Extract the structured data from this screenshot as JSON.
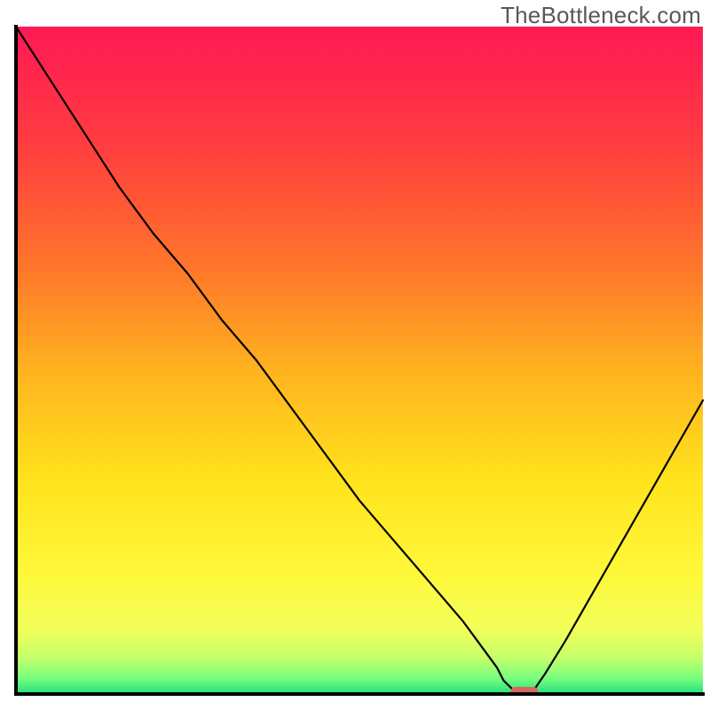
{
  "watermark": "TheBottleneck.com",
  "chart_data": {
    "type": "line",
    "title": "",
    "xlabel": "",
    "ylabel": "",
    "xlim": [
      0,
      100
    ],
    "ylim": [
      0,
      100
    ],
    "x": [
      0,
      5,
      10,
      15,
      20,
      25,
      30,
      35,
      40,
      45,
      50,
      55,
      60,
      65,
      70,
      71,
      72,
      73,
      74,
      75,
      77,
      80,
      85,
      90,
      95,
      100
    ],
    "values": [
      100,
      92,
      84,
      76,
      69,
      63,
      56,
      50,
      43,
      36,
      29,
      23,
      17,
      11,
      4,
      2,
      1,
      0,
      0,
      0,
      3,
      8,
      17,
      26,
      35,
      44
    ],
    "minimum_band": {
      "x0": 72,
      "x1": 76,
      "y": 0
    },
    "gradient_stops": [
      {
        "offset": 0.0,
        "color": "#ff1955"
      },
      {
        "offset": 0.18,
        "color": "#ff3d3f"
      },
      {
        "offset": 0.36,
        "color": "#ff762a"
      },
      {
        "offset": 0.52,
        "color": "#ffb41f"
      },
      {
        "offset": 0.68,
        "color": "#ffe31c"
      },
      {
        "offset": 0.82,
        "color": "#fff83a"
      },
      {
        "offset": 0.9,
        "color": "#f3ff59"
      },
      {
        "offset": 0.945,
        "color": "#c6ff6a"
      },
      {
        "offset": 0.975,
        "color": "#7dff7f"
      },
      {
        "offset": 1.0,
        "color": "#22e07e"
      }
    ],
    "colors": {
      "axis": "#000000",
      "curve": "#000000",
      "band": "#d86464"
    }
  }
}
